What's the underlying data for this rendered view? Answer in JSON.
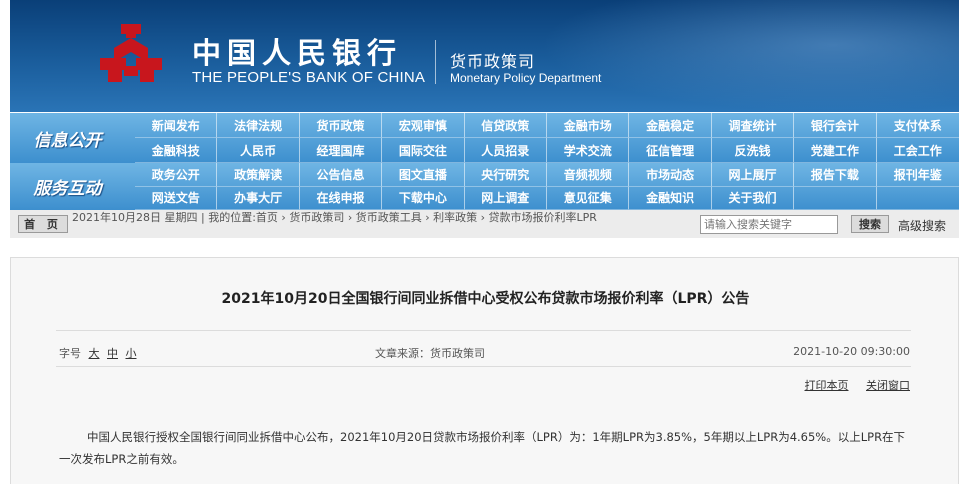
{
  "header": {
    "bank_cn": "中国人民银行",
    "bank_en": "THE PEOPLE'S BANK OF CHINA",
    "dept_cn": "货币政策司",
    "dept_en": "Monetary Policy Department",
    "logo_icon": "pboc-logo-icon",
    "colors": {
      "banner": "#1a5d9c",
      "nav": "#4a9ad6",
      "logo": "#c8161d"
    }
  },
  "nav": {
    "section1_title": "信息公开",
    "section1_items": [
      "新闻发布",
      "法律法规",
      "货币政策",
      "宏观审慎",
      "信贷政策",
      "金融市场",
      "金融稳定",
      "调查统计",
      "银行会计",
      "支付体系",
      "金融科技",
      "人民币",
      "经理国库",
      "国际交往",
      "人员招录",
      "学术交流",
      "征信管理",
      "反洗钱",
      "党建工作",
      "工会工作"
    ],
    "section2_title": "服务互动",
    "section2_items": [
      "政务公开",
      "政策解读",
      "公告信息",
      "图文直播",
      "央行研究",
      "音频视频",
      "市场动态",
      "网上展厅",
      "报告下载",
      "报刊年鉴",
      "网送文告",
      "办事大厅",
      "在线申报",
      "下载中心",
      "网上调查",
      "意见征集",
      "金融知识",
      "关于我们",
      "",
      ""
    ]
  },
  "crumb": {
    "home_label": "首 页",
    "date": "2021年10月28日 星期四",
    "location_label": "我的位置:",
    "path": [
      "首页",
      "货币政策司",
      "货币政策工具",
      "利率政策",
      "贷款市场报价利率LPR"
    ],
    "search_placeholder": "请输入搜索关键字",
    "search_button": "搜索",
    "advanced_search": "高级搜索"
  },
  "article": {
    "title": "2021年10月20日全国银行间同业拆借中心受权公布贷款市场报价利率（LPR）公告",
    "font_size_label": "字号",
    "font_sizes": [
      "大",
      "中",
      "小"
    ],
    "source": "文章来源：货币政策司",
    "date": "2021-10-20 09:30:00",
    "print_label": "打印本页",
    "close_label": "关闭窗口",
    "body": "中国人民银行授权全国银行间同业拆借中心公布，2021年10月20日贷款市场报价利率（LPR）为：1年期LPR为3.85%，5年期以上LPR为4.65%。以上LPR在下一次发布LPR之前有效。"
  }
}
